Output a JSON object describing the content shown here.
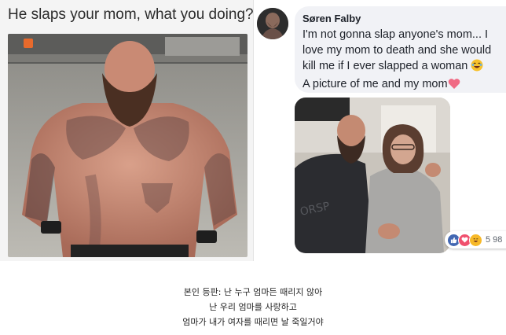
{
  "meme": {
    "caption": "He slaps your mom, what you doing?"
  },
  "comment": {
    "author": "Søren Falby",
    "lines": [
      "I'm not gonna slap anyone's mom... I",
      "love my mom to death and she would",
      "kill me if I ever slapped a woman",
      "A picture of me and my mom"
    ],
    "reactions": {
      "icons": [
        "like-icon",
        "love-icon",
        "haha-icon"
      ],
      "count": "5 98"
    }
  },
  "caption_kr": {
    "lines": [
      "본인 등판: 난 누구 엄마든 때리지 않아",
      "난 우리 엄마를 사랑하고",
      "엄마가 내가 여자를 때리면 날 죽일거야"
    ]
  },
  "colors": {
    "bubble": "#f1f2f6",
    "like": "#4267b2",
    "love": "#f0506e",
    "haha": "#f7b928"
  }
}
